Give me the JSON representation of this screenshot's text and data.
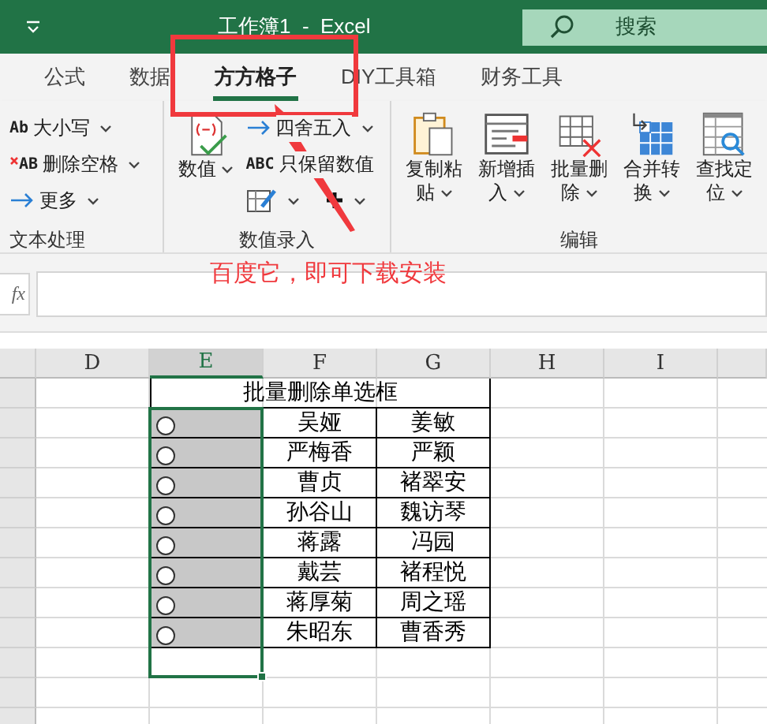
{
  "title_bar": {
    "title": "工作簿1  -  Excel",
    "search": {
      "placeholder": "搜索"
    }
  },
  "tabs": [
    {
      "label": "公式",
      "selected": false
    },
    {
      "label": "数据",
      "selected": false
    },
    {
      "label": "方方格子",
      "selected": true
    },
    {
      "label": "DIY工具箱",
      "selected": false
    },
    {
      "label": "财务工具",
      "selected": false
    }
  ],
  "ribbon": {
    "groups": [
      {
        "label": "文本处理",
        "items": [
          {
            "kind": "small",
            "icon_text": "Ab",
            "label": "大小写",
            "dropdown": true
          },
          {
            "kind": "small",
            "icon_text": "AB",
            "label": "删除空格",
            "dropdown": true
          },
          {
            "kind": "small",
            "label": "更多",
            "dropdown": true
          }
        ]
      },
      {
        "label": "数值录入",
        "items": [
          {
            "kind": "big",
            "label": "数值",
            "dropdown": true
          },
          {
            "kind": "small",
            "label": "四舍五入",
            "dropdown": true
          },
          {
            "kind": "small",
            "icon_text": "ABC",
            "label": "只保留数值",
            "dropdown": false
          },
          {
            "kind": "icon",
            "dropdown": true
          },
          {
            "kind": "icon",
            "dropdown": true
          }
        ]
      },
      {
        "label": "编辑",
        "items": [
          {
            "kind": "big",
            "label": "复制粘贴",
            "dropdown": true
          },
          {
            "kind": "big",
            "label": "新增插入",
            "dropdown": true
          },
          {
            "kind": "big",
            "label": "批量删除",
            "dropdown": true
          },
          {
            "kind": "big",
            "label": "合并转换",
            "dropdown": true
          },
          {
            "kind": "big",
            "label": "查找定位",
            "dropdown": true
          }
        ]
      }
    ]
  },
  "formula_bar": {
    "fx": "fx"
  },
  "annotation": {
    "text": "百度它，即可下载安装"
  },
  "sheet": {
    "columns": [
      {
        "label": "D",
        "selected": false
      },
      {
        "label": "E",
        "selected": true
      },
      {
        "label": "F",
        "selected": false
      },
      {
        "label": "G",
        "selected": false
      },
      {
        "label": "H",
        "selected": false
      },
      {
        "label": "I",
        "selected": false
      }
    ],
    "table": {
      "title": "批量删除单选框",
      "rows": [
        {
          "option": {
            "selected": false
          },
          "cells": [
            "吴娅",
            "姜敏"
          ]
        },
        {
          "option": {
            "selected": false
          },
          "cells": [
            "严梅香",
            "严颖"
          ]
        },
        {
          "option": {
            "selected": false
          },
          "cells": [
            "曹贞",
            "褚翠安"
          ]
        },
        {
          "option": {
            "selected": false
          },
          "cells": [
            "孙谷山",
            "魏访琴"
          ]
        },
        {
          "option": {
            "selected": false
          },
          "cells": [
            "蒋露",
            "冯园"
          ]
        },
        {
          "option": {
            "selected": false
          },
          "cells": [
            "戴芸",
            "褚程悦"
          ]
        },
        {
          "option": {
            "selected": false
          },
          "cells": [
            "蒋厚菊",
            "周之瑶"
          ]
        },
        {
          "option": {
            "selected": false
          },
          "cells": [
            "朱昭东",
            "曹香秀"
          ]
        }
      ]
    }
  }
}
